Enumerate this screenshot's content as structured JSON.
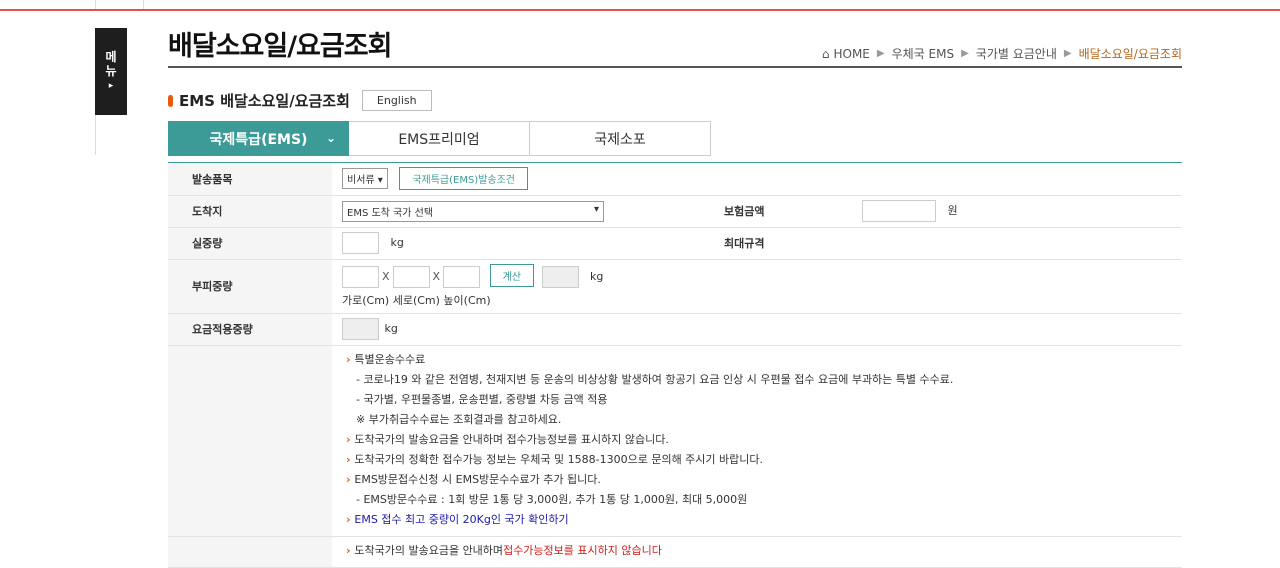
{
  "menu": {
    "label": "메뉴",
    "arrow": "▸"
  },
  "page_title": "배달소요일/요금조회",
  "breadcrumb": {
    "home": "HOME",
    "items": [
      "우체국 EMS",
      "국가별 요금안내"
    ],
    "current": "배달소요일/요금조회"
  },
  "section": {
    "title": "EMS 배달소요일/요금조회",
    "english_button": "English"
  },
  "tabs": [
    "국제특급(EMS)",
    "EMS프리미엄",
    "국제소포"
  ],
  "form": {
    "item_label": "발송품목",
    "item_select": "비서류",
    "item_button": "국제특급(EMS)발송조건",
    "dest_label": "도착지",
    "dest_select": "EMS 도착 국가 선택",
    "insure_label": "보험금액",
    "insure_unit": "원",
    "weight_label": "실중량",
    "weight_unit": "kg",
    "max_label": "최대규격",
    "volume_label": "부피중량",
    "x1": "X",
    "x2": "X",
    "calc_button": "계산",
    "volume_unit": "kg",
    "dims_hint": "가로(Cm) 세로(Cm) 높이(Cm)",
    "applied_label": "요금적용중량",
    "applied_unit": "kg"
  },
  "notes": {
    "n1": "특별운송수수료",
    "n1a": "- 코로나19 와 같은 전염병, 천재지변 등 운송의 비상상황 발생하여 항공기 요금 인상 시 우편물 접수 요금에 부과하는 특별 수수료.",
    "n1b": "- 국가별, 우편물종별, 운송편별, 중량별 차등 금액 적용",
    "n1c": "※ 부가취급수수료는 조회결과를 참고하세요.",
    "n2": "도착국가의 발송요금을 안내하며 접수가능정보를 표시하지 않습니다.",
    "n3": "도착국가의 정확한 접수가능 정보는 우체국 및 1588-1300으로 문의해 주시기 바랍니다.",
    "n4": "EMS방문접수신청 시 EMS방문수수료가 추가 됩니다.",
    "n4a": "- EMS방문수수료 : 1회 방문 1통 당 3,000원, 추가 1통 당 1,000원, 최대 5,000원",
    "n5": "EMS 접수 최고 중량이 20Kg인 국가 확인하기",
    "n6a": "도착국가의 발송요금을 안내하며",
    "n6b": "접수가능정보를 표시하지 않습니다"
  }
}
